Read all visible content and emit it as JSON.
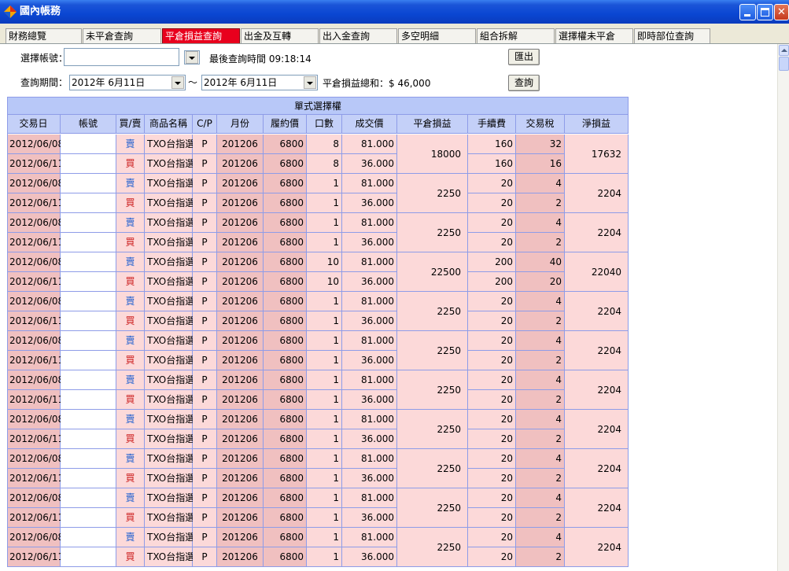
{
  "window": {
    "title": "國內帳務",
    "icon": "app-diamond-icon",
    "controls": [
      "minimize-icon",
      "maximize-icon",
      "close-icon"
    ]
  },
  "tabs": [
    {
      "label": "財務總覽",
      "active": false
    },
    {
      "label": "未平倉查詢",
      "active": false
    },
    {
      "label": "平倉損益查詢",
      "active": true
    },
    {
      "label": "出金及互轉",
      "active": false
    },
    {
      "label": "出入金查詢",
      "active": false
    },
    {
      "label": "多空明細",
      "active": false
    },
    {
      "label": "組合拆解",
      "active": false
    },
    {
      "label": "選擇權未平倉",
      "active": false
    },
    {
      "label": "即時部位查詢",
      "active": false
    }
  ],
  "form": {
    "account_label": "選擇帳號：",
    "account_value": "",
    "last_query_label": "最後查詢時間",
    "last_query_time": "09:18:14",
    "export_button": "匯出",
    "period_label": "查詢期間：",
    "date_from": "2012年  6月11日",
    "date_sep": "～",
    "date_to": "2012年  6月11日",
    "total_label": "平倉損益總和：",
    "total_value": "$ 46,000",
    "query_button": "查詢"
  },
  "grid": {
    "caption": "單式選擇權",
    "columns": [
      "交易日",
      "帳號",
      "買/賣",
      "商品名稱",
      "C/P",
      "月份",
      "履約價",
      "口數",
      "成交價",
      "平倉損益",
      "手續費",
      "交易稅",
      "淨損益"
    ],
    "groups": [
      {
        "pnl": "18000",
        "net": "17632",
        "rows": [
          {
            "date": "2012/06/08",
            "account": "",
            "side": "賣",
            "product": "TXO台指選",
            "cp": "P",
            "month": "201206",
            "strike": "6800",
            "qty": "8",
            "price": "81.000",
            "fee": "160",
            "tax": "32"
          },
          {
            "date": "2012/06/11",
            "account": "",
            "side": "買",
            "product": "TXO台指選",
            "cp": "P",
            "month": "201206",
            "strike": "6800",
            "qty": "8",
            "price": "36.000",
            "fee": "160",
            "tax": "16"
          }
        ]
      },
      {
        "pnl": "2250",
        "net": "2204",
        "rows": [
          {
            "date": "2012/06/08",
            "account": "",
            "side": "賣",
            "product": "TXO台指選",
            "cp": "P",
            "month": "201206",
            "strike": "6800",
            "qty": "1",
            "price": "81.000",
            "fee": "20",
            "tax": "4"
          },
          {
            "date": "2012/06/11",
            "account": "",
            "side": "買",
            "product": "TXO台指選",
            "cp": "P",
            "month": "201206",
            "strike": "6800",
            "qty": "1",
            "price": "36.000",
            "fee": "20",
            "tax": "2"
          }
        ]
      },
      {
        "pnl": "2250",
        "net": "2204",
        "rows": [
          {
            "date": "2012/06/08",
            "account": "",
            "side": "賣",
            "product": "TXO台指選",
            "cp": "P",
            "month": "201206",
            "strike": "6800",
            "qty": "1",
            "price": "81.000",
            "fee": "20",
            "tax": "4"
          },
          {
            "date": "2012/06/11",
            "account": "",
            "side": "買",
            "product": "TXO台指選",
            "cp": "P",
            "month": "201206",
            "strike": "6800",
            "qty": "1",
            "price": "36.000",
            "fee": "20",
            "tax": "2"
          }
        ]
      },
      {
        "pnl": "22500",
        "net": "22040",
        "rows": [
          {
            "date": "2012/06/08",
            "account": "",
            "side": "賣",
            "product": "TXO台指選",
            "cp": "P",
            "month": "201206",
            "strike": "6800",
            "qty": "10",
            "price": "81.000",
            "fee": "200",
            "tax": "40"
          },
          {
            "date": "2012/06/11",
            "account": "",
            "side": "買",
            "product": "TXO台指選",
            "cp": "P",
            "month": "201206",
            "strike": "6800",
            "qty": "10",
            "price": "36.000",
            "fee": "200",
            "tax": "20"
          }
        ]
      },
      {
        "pnl": "2250",
        "net": "2204",
        "rows": [
          {
            "date": "2012/06/08",
            "account": "",
            "side": "賣",
            "product": "TXO台指選",
            "cp": "P",
            "month": "201206",
            "strike": "6800",
            "qty": "1",
            "price": "81.000",
            "fee": "20",
            "tax": "4"
          },
          {
            "date": "2012/06/11",
            "account": "",
            "side": "買",
            "product": "TXO台指選",
            "cp": "P",
            "month": "201206",
            "strike": "6800",
            "qty": "1",
            "price": "36.000",
            "fee": "20",
            "tax": "2"
          }
        ]
      },
      {
        "pnl": "2250",
        "net": "2204",
        "rows": [
          {
            "date": "2012/06/08",
            "account": "",
            "side": "賣",
            "product": "TXO台指選",
            "cp": "P",
            "month": "201206",
            "strike": "6800",
            "qty": "1",
            "price": "81.000",
            "fee": "20",
            "tax": "4"
          },
          {
            "date": "2012/06/11",
            "account": "",
            "side": "買",
            "product": "TXO台指選",
            "cp": "P",
            "month": "201206",
            "strike": "6800",
            "qty": "1",
            "price": "36.000",
            "fee": "20",
            "tax": "2"
          }
        ]
      },
      {
        "pnl": "2250",
        "net": "2204",
        "rows": [
          {
            "date": "2012/06/08",
            "account": "",
            "side": "賣",
            "product": "TXO台指選",
            "cp": "P",
            "month": "201206",
            "strike": "6800",
            "qty": "1",
            "price": "81.000",
            "fee": "20",
            "tax": "4"
          },
          {
            "date": "2012/06/11",
            "account": "",
            "side": "買",
            "product": "TXO台指選",
            "cp": "P",
            "month": "201206",
            "strike": "6800",
            "qty": "1",
            "price": "36.000",
            "fee": "20",
            "tax": "2"
          }
        ]
      },
      {
        "pnl": "2250",
        "net": "2204",
        "rows": [
          {
            "date": "2012/06/08",
            "account": "",
            "side": "賣",
            "product": "TXO台指選",
            "cp": "P",
            "month": "201206",
            "strike": "6800",
            "qty": "1",
            "price": "81.000",
            "fee": "20",
            "tax": "4"
          },
          {
            "date": "2012/06/11",
            "account": "",
            "side": "買",
            "product": "TXO台指選",
            "cp": "P",
            "month": "201206",
            "strike": "6800",
            "qty": "1",
            "price": "36.000",
            "fee": "20",
            "tax": "2"
          }
        ]
      },
      {
        "pnl": "2250",
        "net": "2204",
        "rows": [
          {
            "date": "2012/06/08",
            "account": "",
            "side": "賣",
            "product": "TXO台指選",
            "cp": "P",
            "month": "201206",
            "strike": "6800",
            "qty": "1",
            "price": "81.000",
            "fee": "20",
            "tax": "4"
          },
          {
            "date": "2012/06/11",
            "account": "",
            "side": "買",
            "product": "TXO台指選",
            "cp": "P",
            "month": "201206",
            "strike": "6800",
            "qty": "1",
            "price": "36.000",
            "fee": "20",
            "tax": "2"
          }
        ]
      },
      {
        "pnl": "2250",
        "net": "2204",
        "rows": [
          {
            "date": "2012/06/08",
            "account": "",
            "side": "賣",
            "product": "TXO台指選",
            "cp": "P",
            "month": "201206",
            "strike": "6800",
            "qty": "1",
            "price": "81.000",
            "fee": "20",
            "tax": "4"
          },
          {
            "date": "2012/06/11",
            "account": "",
            "side": "買",
            "product": "TXO台指選",
            "cp": "P",
            "month": "201206",
            "strike": "6800",
            "qty": "1",
            "price": "36.000",
            "fee": "20",
            "tax": "2"
          }
        ]
      },
      {
        "pnl": "2250",
        "net": "2204",
        "rows": [
          {
            "date": "2012/06/08",
            "account": "",
            "side": "賣",
            "product": "TXO台指選",
            "cp": "P",
            "month": "201206",
            "strike": "6800",
            "qty": "1",
            "price": "81.000",
            "fee": "20",
            "tax": "4"
          },
          {
            "date": "2012/06/11",
            "account": "",
            "side": "買",
            "product": "TXO台指選",
            "cp": "P",
            "month": "201206",
            "strike": "6800",
            "qty": "1",
            "price": "36.000",
            "fee": "20",
            "tax": "2"
          }
        ]
      }
    ]
  },
  "colors": {
    "title_bar": "#0a46d2",
    "active_tab": "#e8001d",
    "grid_header": "#c4d0f8",
    "row_fill": "#fcd9d9",
    "row_fill_dark": "#f0c0c0",
    "sell_text": "#2060d0",
    "buy_text": "#cc2020"
  }
}
